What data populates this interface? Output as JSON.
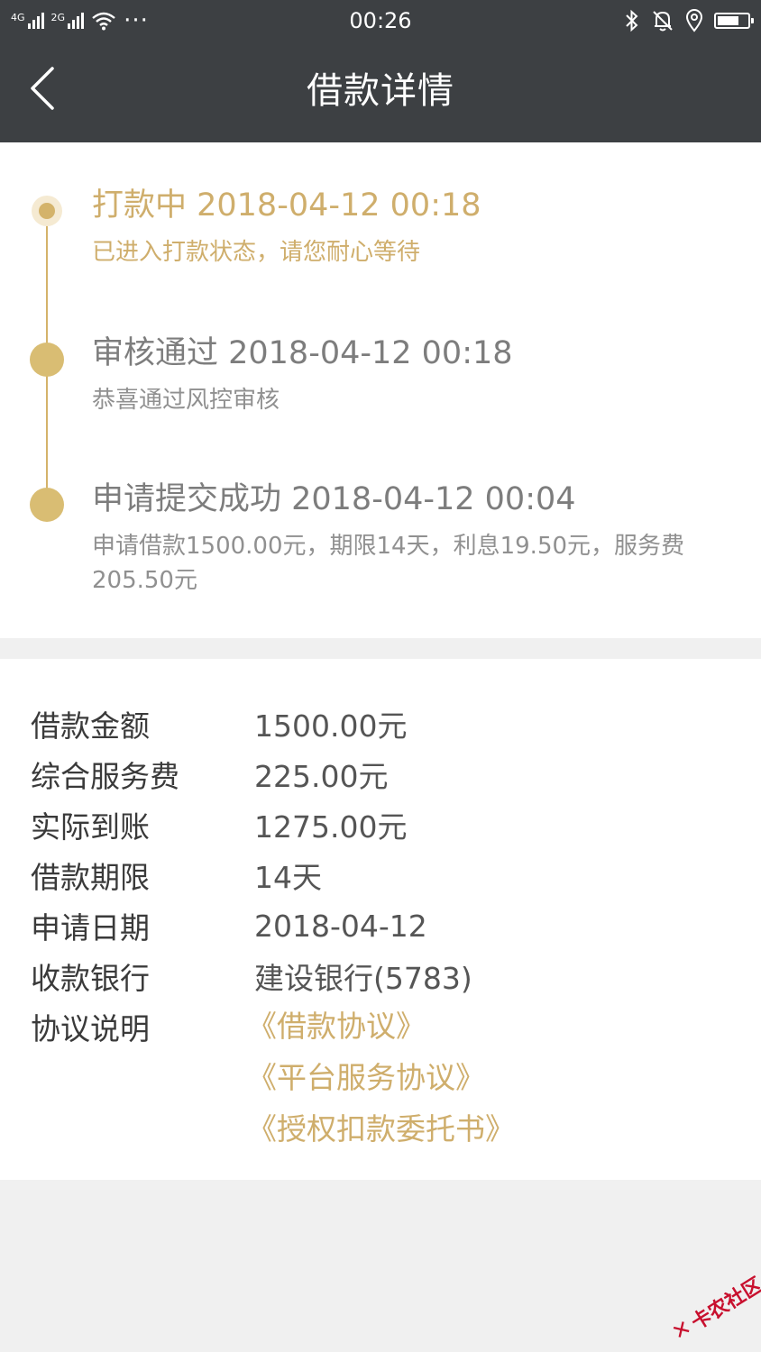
{
  "status_bar": {
    "net1": "4G",
    "net2": "2G",
    "dots": "···",
    "time": "00:26"
  },
  "header": {
    "title": "借款详情",
    "back_icon": "chevron-left-icon"
  },
  "timeline": [
    {
      "title": "打款中 2018-04-12 00:18",
      "desc": "已进入打款状态，请您耐心等待",
      "state": "active"
    },
    {
      "title": "审核通过 2018-04-12 00:18",
      "desc": "恭喜通过风控审核",
      "state": "done"
    },
    {
      "title": "申请提交成功 2018-04-12 00:04",
      "desc": "申请借款1500.00元，期限14天，利息19.50元，服务费205.50元",
      "state": "done"
    }
  ],
  "details": [
    {
      "label": "借款金额",
      "value": "1500.00元"
    },
    {
      "label": "综合服务费",
      "value": "225.00元"
    },
    {
      "label": "实际到账",
      "value": "1275.00元"
    },
    {
      "label": "借款期限",
      "value": "14天"
    },
    {
      "label": "申请日期",
      "value": "2018-04-12"
    },
    {
      "label": "收款银行",
      "value": "建设银行(5783)"
    },
    {
      "label": "协议说明",
      "value": ""
    }
  ],
  "agreements": [
    "《借款协议》",
    "《平台服务协议》",
    "《授权扣款委托书》"
  ],
  "watermark": "卡农社区",
  "colors": {
    "accent": "#cfae6c",
    "header_bg": "#3d4043"
  }
}
